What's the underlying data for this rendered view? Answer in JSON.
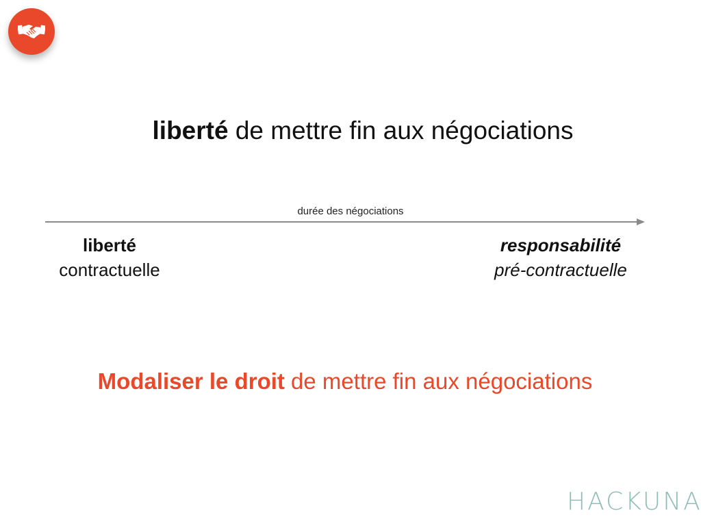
{
  "badge": {
    "icon": "handshake-icon",
    "color": "#e9492a"
  },
  "title": {
    "bold": "liberté",
    "rest": " de mettre fin aux négociations"
  },
  "timeline": {
    "label": "durée des négociations",
    "left": {
      "line1": "liberté",
      "line2": "contractuelle"
    },
    "right": {
      "line1": "responsabilité",
      "line2": "pré-contractuelle"
    }
  },
  "bottom": {
    "bold": "Modaliser le droit",
    "rest": " de mettre fin aux négociations",
    "color": "#e9492a"
  },
  "brand": {
    "name": "HACKUNA",
    "color": "#8fbeb6"
  }
}
